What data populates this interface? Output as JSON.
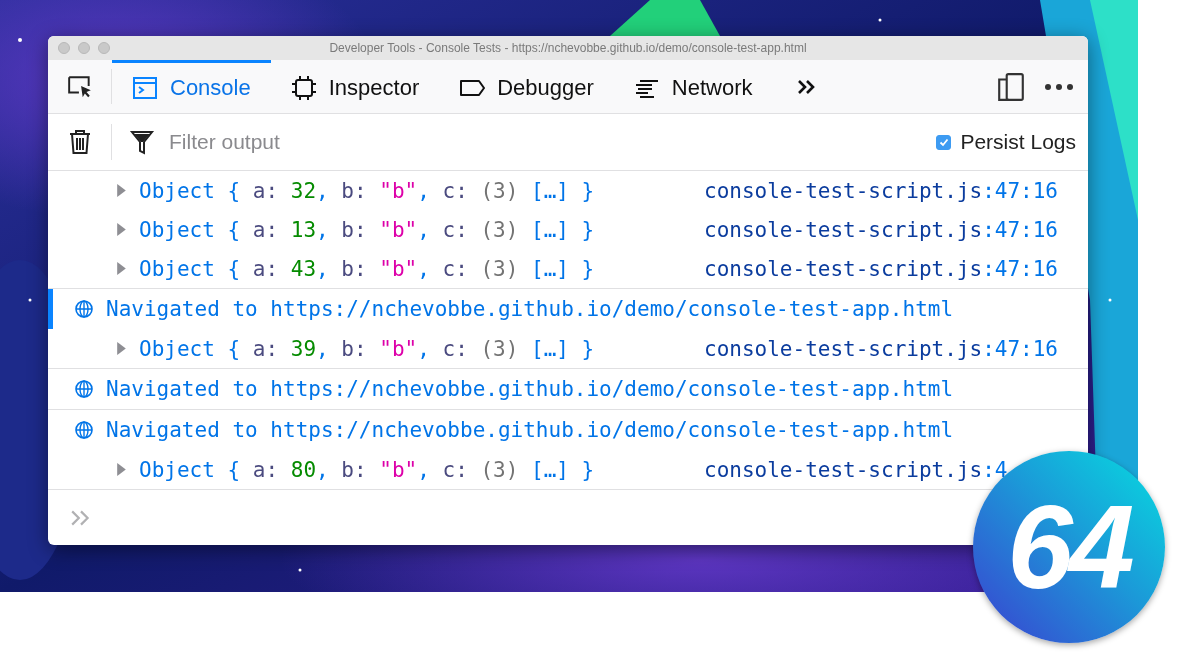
{
  "window": {
    "title": "Developer Tools - Console Tests - https://nchevobbe.github.io/demo/console-test-app.html"
  },
  "tabs": [
    {
      "label": "Console",
      "kind": "console",
      "selected": true
    },
    {
      "label": "Inspector",
      "kind": "inspector",
      "selected": false
    },
    {
      "label": "Debugger",
      "kind": "debugger",
      "selected": false
    },
    {
      "label": "Network",
      "kind": "network",
      "selected": false
    }
  ],
  "filter": {
    "placeholder": "Filter output"
  },
  "persist_logs": {
    "label": "Persist Logs",
    "checked": true
  },
  "messages": [
    {
      "kind": "object",
      "parts": [
        {
          "text": "Object { ",
          "kind": "punct"
        },
        {
          "text": "a:",
          "kind": "key"
        },
        {
          "text": " 32",
          "kind": "number"
        },
        {
          "text": ", ",
          "kind": "punct"
        },
        {
          "text": "b:",
          "kind": "key"
        },
        {
          "text": " \"b\"",
          "kind": "string"
        },
        {
          "text": ", ",
          "kind": "punct"
        },
        {
          "text": "c:",
          "kind": "key"
        },
        {
          "text": " (3)",
          "kind": "length"
        },
        {
          "text": " […] }",
          "kind": "punct"
        }
      ],
      "source": "console-test-script.js",
      "location": ":47:16"
    },
    {
      "kind": "object",
      "parts": [
        {
          "text": "Object { ",
          "kind": "punct"
        },
        {
          "text": "a:",
          "kind": "key"
        },
        {
          "text": " 13",
          "kind": "number"
        },
        {
          "text": ", ",
          "kind": "punct"
        },
        {
          "text": "b:",
          "kind": "key"
        },
        {
          "text": " \"b\"",
          "kind": "string"
        },
        {
          "text": ", ",
          "kind": "punct"
        },
        {
          "text": "c:",
          "kind": "key"
        },
        {
          "text": " (3)",
          "kind": "length"
        },
        {
          "text": " […] }",
          "kind": "punct"
        }
      ],
      "source": "console-test-script.js",
      "location": ":47:16"
    },
    {
      "kind": "object",
      "parts": [
        {
          "text": "Object { ",
          "kind": "punct"
        },
        {
          "text": "a:",
          "kind": "key"
        },
        {
          "text": " 43",
          "kind": "number"
        },
        {
          "text": ", ",
          "kind": "punct"
        },
        {
          "text": "b:",
          "kind": "key"
        },
        {
          "text": " \"b\"",
          "kind": "string"
        },
        {
          "text": ", ",
          "kind": "punct"
        },
        {
          "text": "c:",
          "kind": "key"
        },
        {
          "text": " (3)",
          "kind": "length"
        },
        {
          "text": " […] }",
          "kind": "punct"
        }
      ],
      "source": "console-test-script.js",
      "location": ":47:16"
    },
    {
      "kind": "navigation",
      "text": "Navigated to https://nchevobbe.github.io/demo/console-test-app.html",
      "highlighted": true
    },
    {
      "kind": "object",
      "parts": [
        {
          "text": "Object { ",
          "kind": "punct"
        },
        {
          "text": "a:",
          "kind": "key"
        },
        {
          "text": " 39",
          "kind": "number"
        },
        {
          "text": ", ",
          "kind": "punct"
        },
        {
          "text": "b:",
          "kind": "key"
        },
        {
          "text": " \"b\"",
          "kind": "string"
        },
        {
          "text": ", ",
          "kind": "punct"
        },
        {
          "text": "c:",
          "kind": "key"
        },
        {
          "text": " (3)",
          "kind": "length"
        },
        {
          "text": " […] }",
          "kind": "punct"
        }
      ],
      "source": "console-test-script.js",
      "location": ":47:16"
    },
    {
      "kind": "navigation",
      "text": "Navigated to https://nchevobbe.github.io/demo/console-test-app.html",
      "highlighted": false
    },
    {
      "kind": "navigation",
      "text": "Navigated to https://nchevobbe.github.io/demo/console-test-app.html",
      "highlighted": false
    },
    {
      "kind": "object",
      "parts": [
        {
          "text": "Object { ",
          "kind": "punct"
        },
        {
          "text": "a:",
          "kind": "key"
        },
        {
          "text": " 80",
          "kind": "number"
        },
        {
          "text": ", ",
          "kind": "punct"
        },
        {
          "text": "b:",
          "kind": "key"
        },
        {
          "text": " \"b\"",
          "kind": "string"
        },
        {
          "text": ", ",
          "kind": "punct"
        },
        {
          "text": "c:",
          "kind": "key"
        },
        {
          "text": " (3)",
          "kind": "length"
        },
        {
          "text": " […] }",
          "kind": "punct"
        }
      ],
      "source": "console-test-script.js",
      "location": ":4"
    }
  ],
  "badge": {
    "text": "64"
  }
}
